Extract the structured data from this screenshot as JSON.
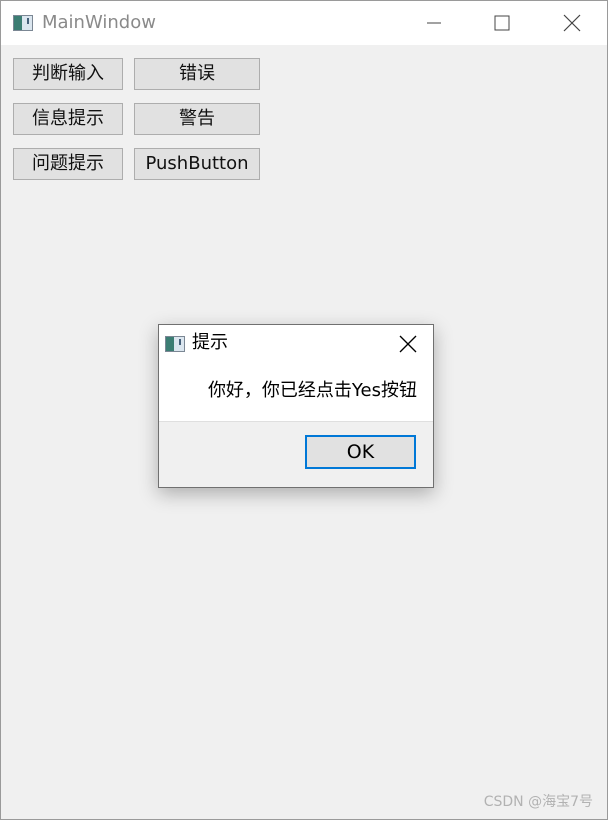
{
  "window": {
    "title": "MainWindow",
    "icon": "qt-app-icon",
    "controls": [
      "minimize-icon",
      "maximize-icon",
      "close-icon"
    ]
  },
  "buttons": {
    "judge_input": "判断输入",
    "error": "错误",
    "info_tip": "信息提示",
    "warning": "警告",
    "question_tip": "问题提示",
    "push_button": "PushButton"
  },
  "dialog": {
    "title": "提示",
    "message": "你好，你已经点击Yes按钮",
    "ok_label": "OK",
    "accent_color": "#0078d7"
  },
  "watermark": "CSDN @海宝7号"
}
